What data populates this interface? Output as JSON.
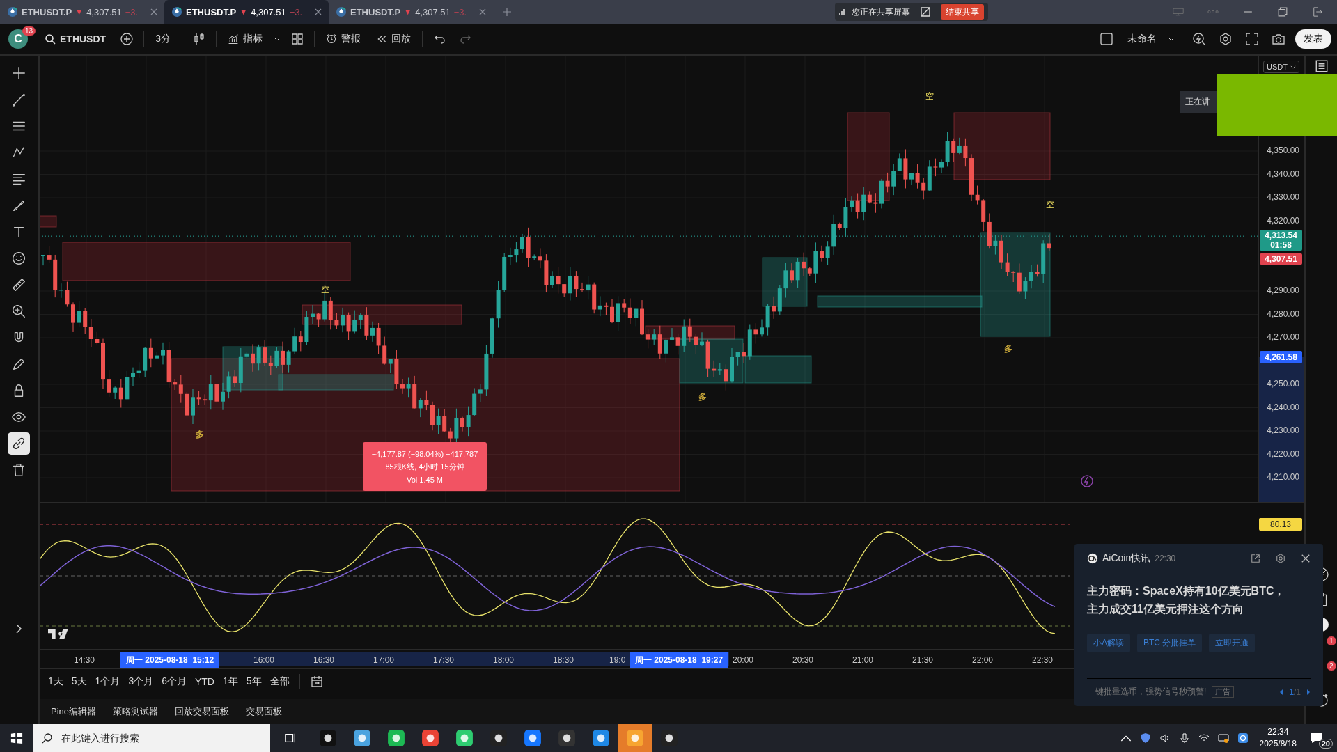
{
  "browser_tabs": [
    {
      "symbol": "ETHUSDT.P",
      "arrow": "▼",
      "price": "4,307.51",
      "change": "−3.",
      "selected": false
    },
    {
      "symbol": "ETHUSDT.P",
      "arrow": "▼",
      "price": "4,307.51",
      "change": "−3.",
      "selected": true
    },
    {
      "symbol": "ETHUSDT.P",
      "arrow": "▼",
      "price": "4,307.51",
      "change": "−3.",
      "selected": false
    }
  ],
  "share_bar": {
    "status": "您正在共享屏幕",
    "stop_button": "结束共享"
  },
  "toolbar": {
    "avatar_letter": "C",
    "notification_count": "13",
    "symbol": "ETHUSDT",
    "interval": "3分",
    "indicators": "指标",
    "alerts": "警报",
    "replay": "回放",
    "layout_name": "未命名",
    "publish": "发表"
  },
  "drawing_tools": [
    {
      "selected": false
    },
    {
      "selected": false
    },
    {
      "selected": false
    },
    {
      "selected": false
    },
    {
      "selected": false
    },
    {
      "selected": false
    },
    {
      "selected": false
    },
    {
      "selected": false
    },
    {
      "selected": false
    },
    {
      "selected": false
    },
    {
      "selected": false
    },
    {
      "selected": false
    },
    {
      "selected": false
    },
    {
      "selected": false
    },
    {
      "selected": true
    },
    {
      "selected": false
    }
  ],
  "chart": {
    "currency": "USDT",
    "speaking_label": "正在讲",
    "price_labels": [
      "4,350.00",
      "4,340.00",
      "4,330.00",
      "4,320.00",
      "4,290.00",
      "4,280.00",
      "4,270.00",
      "4,250.00",
      "4,240.00",
      "4,230.00",
      "4,220.00",
      "4,210.00"
    ],
    "last_price": "4,313.54",
    "countdown": "01:58",
    "bid_price": "4,307.51",
    "cursor_price": "4,261.58",
    "oscillator_value": "80.13",
    "signals": [
      {
        "text": "空",
        "kind": "sell"
      },
      {
        "text": "空",
        "kind": "sell"
      },
      {
        "text": "空",
        "kind": "sell"
      },
      {
        "text": "多",
        "kind": "buy"
      },
      {
        "text": "多",
        "kind": "buy"
      },
      {
        "text": "多",
        "kind": "buy"
      }
    ],
    "measure": {
      "change": "−4,177.87 (−98.04%) −417,787",
      "bars": "85根K线, 4小时 15分钟",
      "volume": "Vol 1.45 M"
    }
  },
  "time_axis": {
    "labels": [
      "14:30",
      "16:00",
      "16:30",
      "17:00",
      "17:30",
      "18:00",
      "18:30",
      "19:0",
      "20:00",
      "20:30",
      "21:00",
      "21:30",
      "22:00",
      "22:30"
    ],
    "cursor_start": "周一 2025-08-18  15:12",
    "cursor_end": "周一 2025-08-18  19:27"
  },
  "ranges": [
    "1天",
    "5天",
    "1个月",
    "3个月",
    "6个月",
    "YTD",
    "1年",
    "5年",
    "全部"
  ],
  "bottom_tabs": [
    "Pine编辑器",
    "策略测试器",
    "回放交易面板",
    "交易面板"
  ],
  "side_badges": [
    "1",
    "2"
  ],
  "news": {
    "source": "AiCoin快讯",
    "time": "22:30",
    "headline_lines": [
      "主力密码：SpaceX持有10亿美元BTC，",
      "主力成交11亿美元押注这个方向"
    ],
    "actions": [
      "小A解读",
      "BTC 分批挂单",
      "立即开通"
    ],
    "promo": "一键批量选币，强势信号秒预警!",
    "ad_tag": "广告",
    "page": "1",
    "pages": "/1"
  },
  "taskbar": {
    "search_placeholder": "在此键入进行搜索",
    "time": "22:34",
    "date": "2025/8/18",
    "notification_count": "20"
  }
}
